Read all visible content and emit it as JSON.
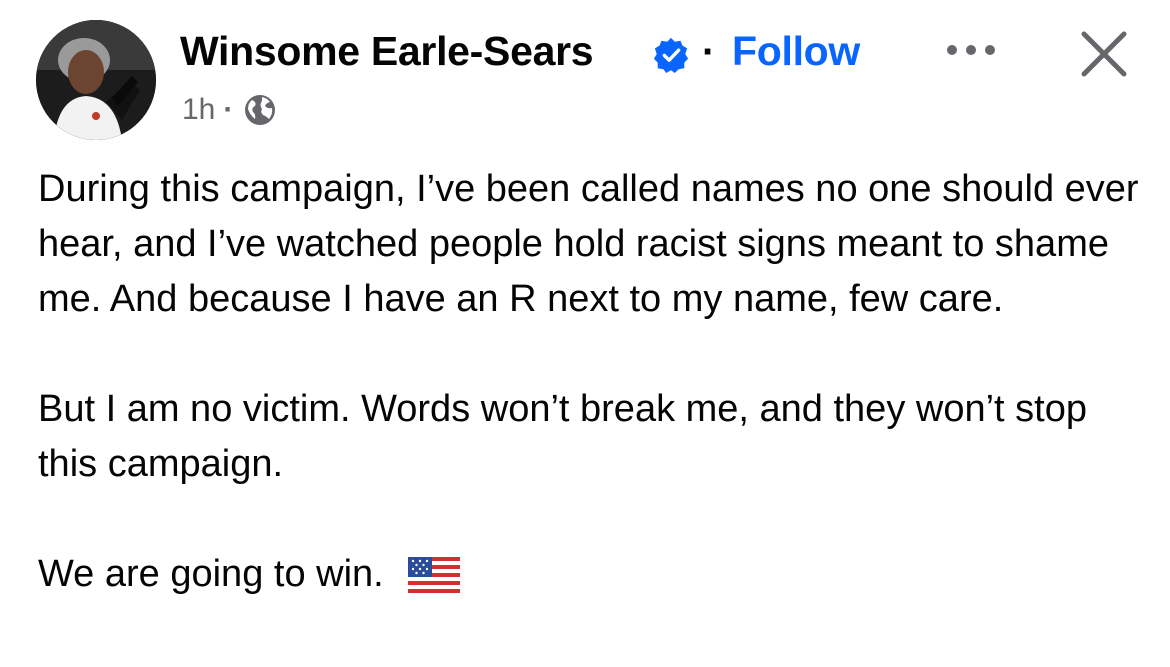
{
  "post": {
    "author_name": "Winsome Earle-Sears",
    "separator": "·",
    "follow_label": "Follow",
    "timestamp": "1h",
    "meta_separator": "·",
    "audience_icon": "globe-icon",
    "verified_icon": "verified-badge-icon",
    "body": {
      "paragraph_1": "During this campaign, I’ve been called names no one should ever hear, and I’ve watched people hold racist signs meant to shame me. And because I have an R next to my name, few care.",
      "paragraph_2": "But I am no victim. Words won’t break me, and they won’t stop this campaign.",
      "paragraph_3": "We are going to win.",
      "emoji": "us-flag-emoji"
    }
  },
  "actions": {
    "more_icon": "more-options-icon",
    "close_icon": "close-icon"
  },
  "colors": {
    "follow_blue": "#0866ff",
    "verified_blue": "#0866ff",
    "meta_gray": "#65676b",
    "text": "#050505"
  }
}
